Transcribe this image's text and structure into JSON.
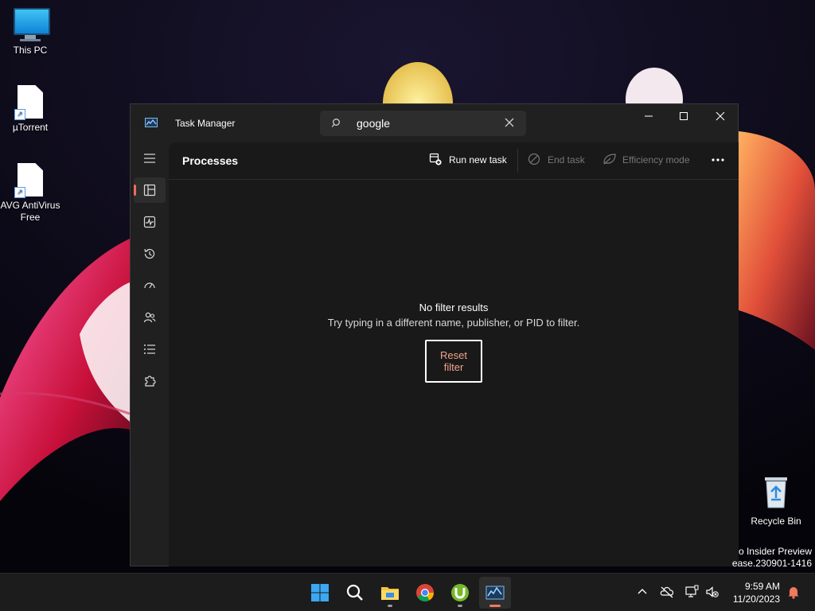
{
  "desktop": {
    "icons": [
      {
        "label": "This PC"
      },
      {
        "label": "µTorrent"
      },
      {
        "label": "AVG AntiVirus Free"
      },
      {
        "label": "Recycle Bin"
      }
    ],
    "watermark_line1": "o Insider Preview",
    "watermark_line2": "ease.230901-1416"
  },
  "window": {
    "title": "Task Manager",
    "search": {
      "value": "google"
    },
    "page_title": "Processes",
    "toolbar": {
      "run_new_task": "Run new task",
      "end_task": "End task",
      "efficiency_mode": "Efficiency mode"
    },
    "empty_state": {
      "title": "No filter results",
      "subtitle": "Try typing in a different name, publisher, or PID to filter.",
      "reset_button": "Reset filter"
    },
    "nav_items": [
      "processes",
      "performance",
      "app-history",
      "startup-apps",
      "users",
      "details",
      "services"
    ]
  },
  "taskbar": {
    "time": "9:59 AM",
    "date": "11/20/2023"
  },
  "colors": {
    "accent": "#f06b5a",
    "reset_text": "#f0a38a",
    "window_bg": "#202020",
    "content_bg": "#191919"
  }
}
